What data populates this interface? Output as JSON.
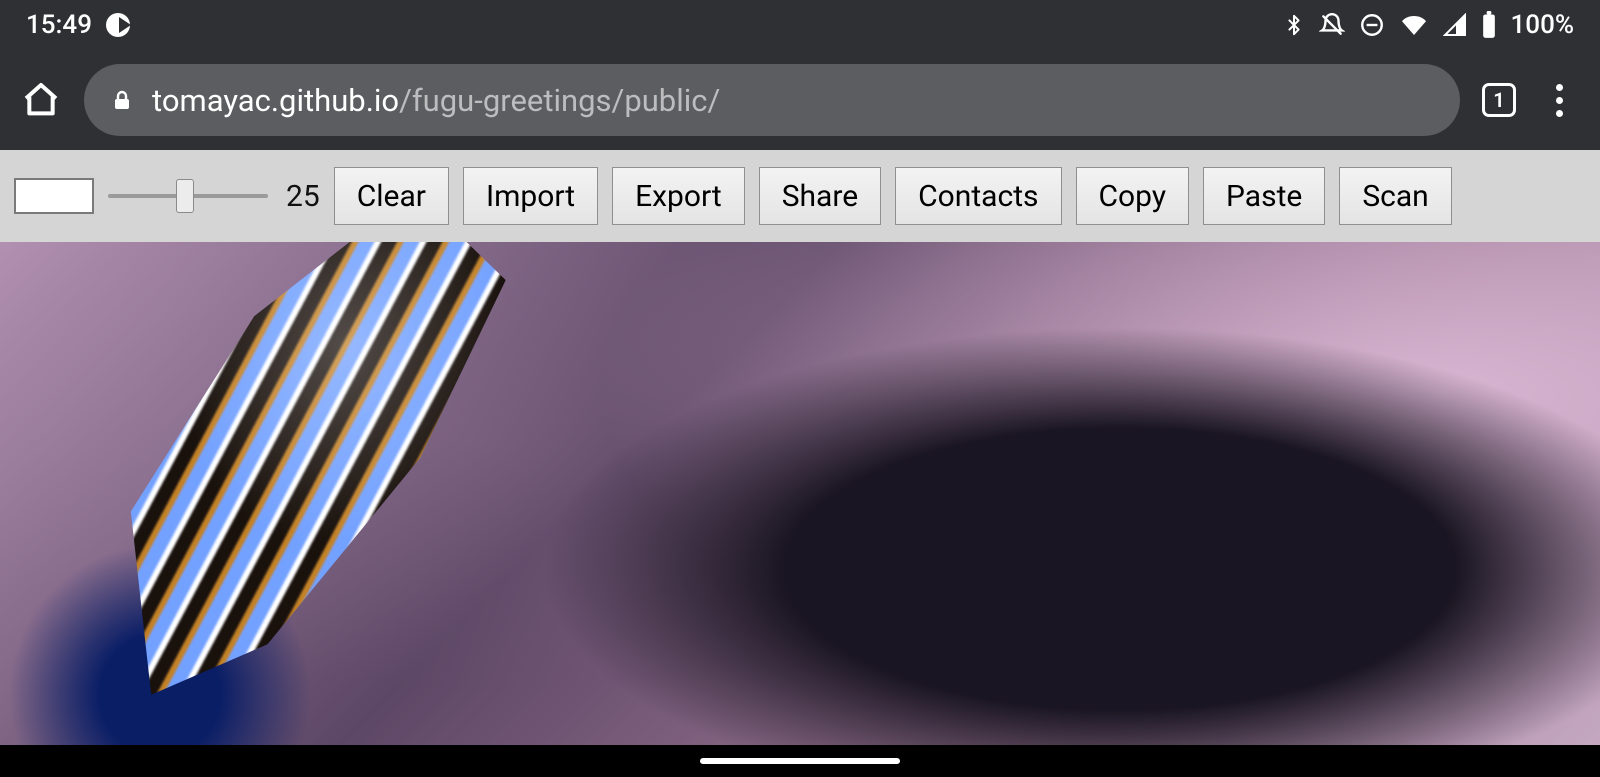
{
  "status": {
    "time": "15:49",
    "battery_pct": "100%"
  },
  "browser": {
    "tab_count": "1",
    "url_host": "tomayac.github.io",
    "url_path": "/fugu-greetings/public/"
  },
  "toolbar": {
    "slider_value": "25",
    "buttons": {
      "clear": "Clear",
      "import": "Import",
      "export": "Export",
      "share": "Share",
      "contacts": "Contacts",
      "copy": "Copy",
      "paste": "Paste",
      "scan": "Scan"
    }
  }
}
